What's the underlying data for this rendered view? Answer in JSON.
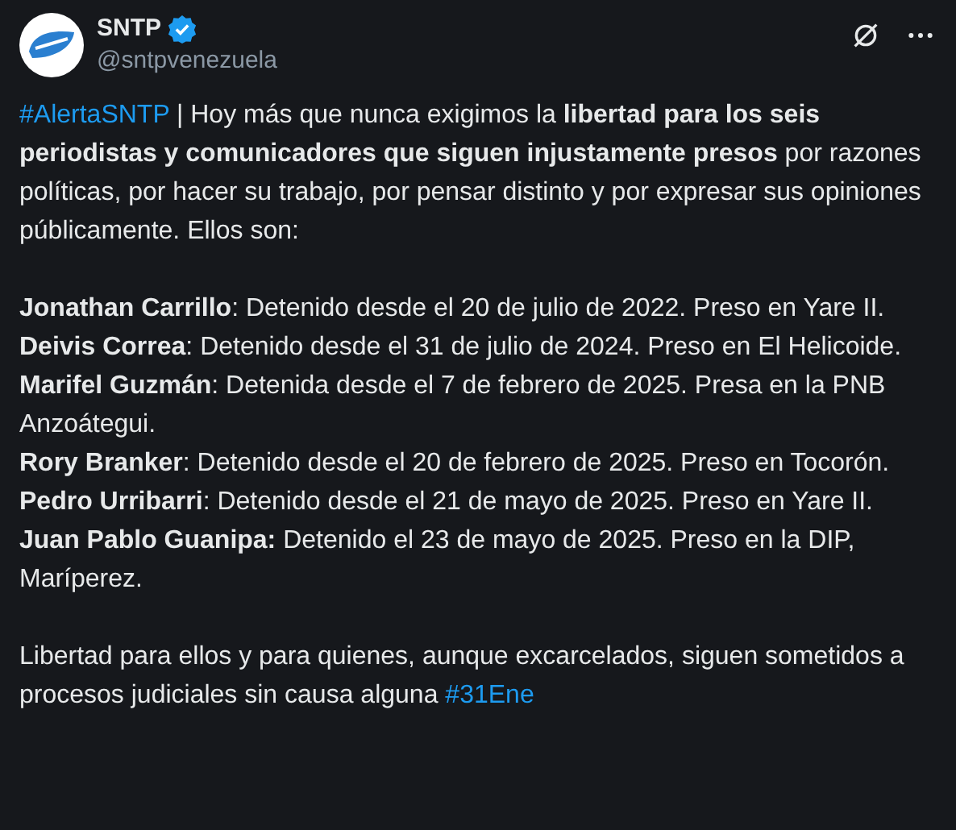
{
  "account": {
    "name": "SNTP",
    "verified": true,
    "handle": "@sntpvenezuela"
  },
  "post": {
    "intro": {
      "hashtag": "#AlertaSNTP",
      "text": "| Hoy más que nunca exigimos la **libertad para los seis periodistas y comunicadores que siguen injustamente presos** por razones políticas, por hacer su trabajo, por pensar distinto y por expresar sus opiniones públicamente. Ellos son:"
    },
    "detainees": [
      {
        "text": "**Jonathan Carrillo**: Detenido desde el 20 de julio de 2022. Preso en Yare II."
      },
      {
        "text": "**Deivis Correa**: Detenido desde el 31 de julio de 2024. Preso en El Helicoide."
      },
      {
        "text": "**Marifel Guzmán**: Detenida desde el 7 de febrero de 2025. Presa en la PNB Anzoátegui."
      },
      {
        "text": "**Rory Branker**: Detenido desde el 20 de febrero de 2025. Preso en Tocorón."
      },
      {
        "text": "**Pedro Urribarri**: Detenido desde el 21 de mayo de 2025. Preso en Yare II."
      },
      {
        "text": "**Juan Pablo Guanipa:** Detenido el 23 de mayo de 2025. Preso en la DIP, Maríperez."
      }
    ],
    "closing": {
      "text": "Libertad para ellos y para quienes, aunque excarcelados, siguen sometidos a procesos judiciales sin causa alguna",
      "hashtag": "#31Ene"
    }
  }
}
